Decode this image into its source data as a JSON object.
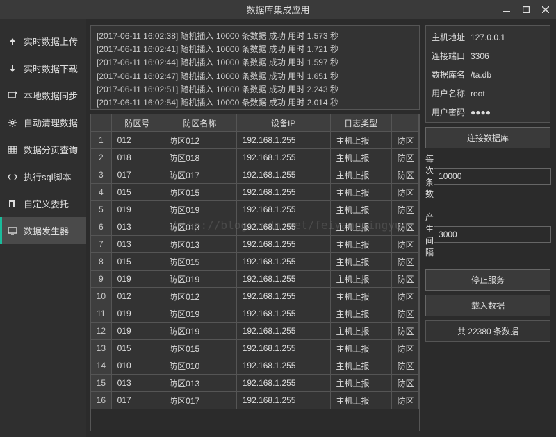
{
  "window": {
    "title": "数据库集成应用"
  },
  "sidebar": {
    "items": [
      {
        "label": "实时数据上传"
      },
      {
        "label": "实时数据下载"
      },
      {
        "label": "本地数据同步"
      },
      {
        "label": "自动清理数据"
      },
      {
        "label": "数据分页查询"
      },
      {
        "label": "执行sql脚本"
      },
      {
        "label": "自定义委托"
      },
      {
        "label": "数据发生器"
      }
    ]
  },
  "log": {
    "lines": [
      "[2017-06-11 16:02:38]  随机插入 10000 条数据 成功  用时 1.573 秒",
      "[2017-06-11 16:02:41]  随机插入 10000 条数据 成功  用时 1.721 秒",
      "[2017-06-11 16:02:44]  随机插入 10000 条数据 成功  用时 1.597 秒",
      "[2017-06-11 16:02:47]  随机插入 10000 条数据 成功  用时 1.651 秒",
      "[2017-06-11 16:02:51]  随机插入 10000 条数据 成功  用时 2.243 秒",
      "[2017-06-11 16:02:54]  随机插入 10000 条数据 成功  用时 2.014 秒"
    ]
  },
  "table": {
    "headers": [
      "",
      "防区号",
      "防区名称",
      "设备IP",
      "日志类型",
      ""
    ],
    "rows": [
      [
        "1",
        "012",
        "防区012",
        "192.168.1.255",
        "主机上报",
        "防区"
      ],
      [
        "2",
        "018",
        "防区018",
        "192.168.1.255",
        "主机上报",
        "防区"
      ],
      [
        "3",
        "017",
        "防区017",
        "192.168.1.255",
        "主机上报",
        "防区"
      ],
      [
        "4",
        "015",
        "防区015",
        "192.168.1.255",
        "主机上报",
        "防区"
      ],
      [
        "5",
        "019",
        "防区019",
        "192.168.1.255",
        "主机上报",
        "防区"
      ],
      [
        "6",
        "013",
        "防区013",
        "192.168.1.255",
        "主机上报",
        "防区"
      ],
      [
        "7",
        "013",
        "防区013",
        "192.168.1.255",
        "主机上报",
        "防区"
      ],
      [
        "8",
        "015",
        "防区015",
        "192.168.1.255",
        "主机上报",
        "防区"
      ],
      [
        "9",
        "019",
        "防区019",
        "192.168.1.255",
        "主机上报",
        "防区"
      ],
      [
        "10",
        "012",
        "防区012",
        "192.168.1.255",
        "主机上报",
        "防区"
      ],
      [
        "11",
        "019",
        "防区019",
        "192.168.1.255",
        "主机上报",
        "防区"
      ],
      [
        "12",
        "019",
        "防区019",
        "192.168.1.255",
        "主机上报",
        "防区"
      ],
      [
        "13",
        "015",
        "防区015",
        "192.168.1.255",
        "主机上报",
        "防区"
      ],
      [
        "14",
        "010",
        "防区010",
        "192.168.1.255",
        "主机上报",
        "防区"
      ],
      [
        "15",
        "013",
        "防区013",
        "192.168.1.255",
        "主机上报",
        "防区"
      ],
      [
        "16",
        "017",
        "防区017",
        "192.168.1.255",
        "主机上报",
        "防区"
      ]
    ]
  },
  "conn": {
    "host_label": "主机地址",
    "host": "127.0.0.1",
    "port_label": "连接端口",
    "port": "3306",
    "db_label": "数据库名",
    "db": "/ta.db",
    "user_label": "用户名称",
    "user": "root",
    "pass_label": "用户密码",
    "pass": "●●●●",
    "connect_btn": "连接数据库"
  },
  "gen": {
    "batch_label": "每次条数",
    "batch": "10000",
    "interval_label": "产生间隔",
    "interval": "3000",
    "stop_btn": "停止服务",
    "load_btn": "载入数据",
    "count_text": "共 22380 条数据"
  },
  "watermark": "http://blog.csdn.net/feiyangqingyun"
}
